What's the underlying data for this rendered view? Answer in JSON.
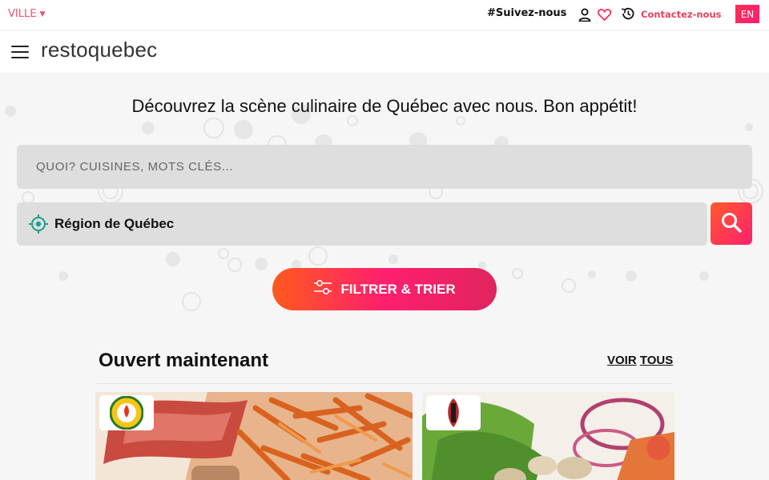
{
  "topbar": {
    "city_label": "VILLE",
    "follow_label": "#Suivez-nous",
    "contact_label": "Contactez-nous",
    "lang_label": "EN"
  },
  "header": {
    "logo_text": "restoquebec"
  },
  "hero": {
    "tagline": "Découvrez la scène culinaire de Québec avec nous. Bon appétit!",
    "search_placeholder": "QUOI? CUISINES, MOTS CLÉS...",
    "region_label": "Région de Québec",
    "filter_label": "FILTRER & TRIER"
  },
  "section": {
    "title": "Ouvert maintenant",
    "view_all_1": "VOIR",
    "view_all_2": "TOUS"
  },
  "colors": {
    "accent": "#ff2d55",
    "accent_orange": "#ff5a1e",
    "region_pin": "#1a9f8f"
  },
  "icons": [
    "chevron-down-icon",
    "user-icon",
    "heart-icon",
    "history-icon",
    "menu-icon",
    "location-target-icon",
    "search-icon",
    "filter-sliders-icon"
  ]
}
